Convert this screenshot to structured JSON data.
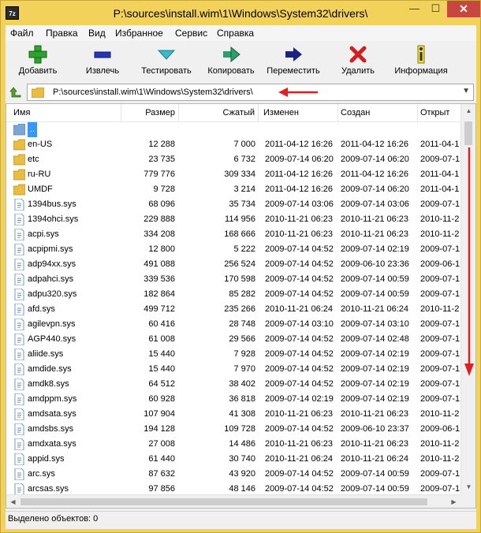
{
  "window": {
    "title": "P:\\sources\\install.wim\\1\\Windows\\System32\\drivers\\",
    "app_icon_text": "7z",
    "min_glyph": "—",
    "max_glyph": "☐",
    "close_glyph": "✕"
  },
  "menu": [
    "Файл",
    "Правка",
    "Вид",
    "Избранное",
    "Сервис",
    "Справка"
  ],
  "toolbar": [
    {
      "label": "Добавить",
      "icon": "plus-icon",
      "color": "#2ea12e"
    },
    {
      "label": "Извлечь",
      "icon": "minus-icon",
      "color": "#2436b8"
    },
    {
      "label": "Тестировать",
      "icon": "check-arrow-icon",
      "color": "#3bb8c9"
    },
    {
      "label": "Копировать",
      "icon": "copy-arrow-icon",
      "color": "#2e9d6f"
    },
    {
      "label": "Переместить",
      "icon": "move-arrow-icon",
      "color": "#1a237e"
    },
    {
      "label": "Удалить",
      "icon": "delete-x-icon",
      "color": "#d11f1f"
    },
    {
      "label": "Информация",
      "icon": "info-icon",
      "color": "#e3c61c"
    }
  ],
  "address": {
    "path": "P:\\sources\\install.wim\\1\\Windows\\System32\\drivers\\",
    "annotation_color": "#e02020"
  },
  "columns": [
    "Имя",
    "Размер",
    "Сжатый",
    "Изменен",
    "Создан",
    "Открыт"
  ],
  "rows": [
    {
      "name": "..",
      "type": "up",
      "size": "",
      "packed": "",
      "modified": "",
      "created": "",
      "accessed": ""
    },
    {
      "name": "en-US",
      "type": "folder",
      "size": "12 288",
      "packed": "7 000",
      "modified": "2011-04-12 16:26",
      "created": "2011-04-12 16:26",
      "accessed": "2011-04-1"
    },
    {
      "name": "etc",
      "type": "folder",
      "size": "23 735",
      "packed": "6 732",
      "modified": "2009-07-14 06:20",
      "created": "2009-07-14 06:20",
      "accessed": "2009-07-1"
    },
    {
      "name": "ru-RU",
      "type": "folder",
      "size": "779 776",
      "packed": "309 334",
      "modified": "2011-04-12 16:26",
      "created": "2011-04-12 16:26",
      "accessed": "2011-04-1"
    },
    {
      "name": "UMDF",
      "type": "folder",
      "size": "9 728",
      "packed": "3 214",
      "modified": "2011-04-12 16:26",
      "created": "2009-07-14 06:20",
      "accessed": "2011-04-1"
    },
    {
      "name": "1394bus.sys",
      "type": "file",
      "size": "68 096",
      "packed": "35 734",
      "modified": "2009-07-14 03:06",
      "created": "2009-07-14 03:06",
      "accessed": "2009-07-1"
    },
    {
      "name": "1394ohci.sys",
      "type": "file",
      "size": "229 888",
      "packed": "114 956",
      "modified": "2010-11-21 06:23",
      "created": "2010-11-21 06:23",
      "accessed": "2010-11-2"
    },
    {
      "name": "acpi.sys",
      "type": "file",
      "size": "334 208",
      "packed": "168 666",
      "modified": "2010-11-21 06:23",
      "created": "2010-11-21 06:23",
      "accessed": "2010-11-2"
    },
    {
      "name": "acpipmi.sys",
      "type": "file",
      "size": "12 800",
      "packed": "5 222",
      "modified": "2009-07-14 04:52",
      "created": "2009-07-14 02:19",
      "accessed": "2009-07-1"
    },
    {
      "name": "adp94xx.sys",
      "type": "file",
      "size": "491 088",
      "packed": "256 524",
      "modified": "2009-07-14 04:52",
      "created": "2009-06-10 23:36",
      "accessed": "2009-06-1"
    },
    {
      "name": "adpahci.sys",
      "type": "file",
      "size": "339 536",
      "packed": "170 598",
      "modified": "2009-07-14 04:52",
      "created": "2009-07-14 00:59",
      "accessed": "2009-07-1"
    },
    {
      "name": "adpu320.sys",
      "type": "file",
      "size": "182 864",
      "packed": "85 282",
      "modified": "2009-07-14 04:52",
      "created": "2009-07-14 00:59",
      "accessed": "2009-07-1"
    },
    {
      "name": "afd.sys",
      "type": "file",
      "size": "499 712",
      "packed": "235 266",
      "modified": "2010-11-21 06:24",
      "created": "2010-11-21 06:24",
      "accessed": "2010-11-2"
    },
    {
      "name": "agilevpn.sys",
      "type": "file",
      "size": "60 416",
      "packed": "28 748",
      "modified": "2009-07-14 03:10",
      "created": "2009-07-14 03:10",
      "accessed": "2009-07-1"
    },
    {
      "name": "AGP440.sys",
      "type": "file",
      "size": "61 008",
      "packed": "29 566",
      "modified": "2009-07-14 04:52",
      "created": "2009-07-14 02:48",
      "accessed": "2009-07-1"
    },
    {
      "name": "aliide.sys",
      "type": "file",
      "size": "15 440",
      "packed": "7 928",
      "modified": "2009-07-14 04:52",
      "created": "2009-07-14 02:19",
      "accessed": "2009-07-1"
    },
    {
      "name": "amdide.sys",
      "type": "file",
      "size": "15 440",
      "packed": "7 970",
      "modified": "2009-07-14 04:52",
      "created": "2009-07-14 02:19",
      "accessed": "2009-07-1"
    },
    {
      "name": "amdk8.sys",
      "type": "file",
      "size": "64 512",
      "packed": "38 402",
      "modified": "2009-07-14 04:52",
      "created": "2009-07-14 02:19",
      "accessed": "2009-07-1"
    },
    {
      "name": "amdppm.sys",
      "type": "file",
      "size": "60 928",
      "packed": "36 818",
      "modified": "2009-07-14 02:19",
      "created": "2009-07-14 02:19",
      "accessed": "2009-07-1"
    },
    {
      "name": "amdsata.sys",
      "type": "file",
      "size": "107 904",
      "packed": "41 308",
      "modified": "2010-11-21 06:23",
      "created": "2010-11-21 06:23",
      "accessed": "2010-11-2"
    },
    {
      "name": "amdsbs.sys",
      "type": "file",
      "size": "194 128",
      "packed": "109 728",
      "modified": "2009-07-14 04:52",
      "created": "2009-06-10 23:37",
      "accessed": "2009-06-1"
    },
    {
      "name": "amdxata.sys",
      "type": "file",
      "size": "27 008",
      "packed": "14 486",
      "modified": "2010-11-21 06:23",
      "created": "2010-11-21 06:23",
      "accessed": "2010-11-2"
    },
    {
      "name": "appid.sys",
      "type": "file",
      "size": "61 440",
      "packed": "30 740",
      "modified": "2010-11-21 06:24",
      "created": "2010-11-21 06:24",
      "accessed": "2010-11-2"
    },
    {
      "name": "arc.sys",
      "type": "file",
      "size": "87 632",
      "packed": "43 920",
      "modified": "2009-07-14 04:52",
      "created": "2009-07-14 00:59",
      "accessed": "2009-07-1"
    },
    {
      "name": "arcsas.sys",
      "type": "file",
      "size": "97 856",
      "packed": "48 146",
      "modified": "2009-07-14 04:52",
      "created": "2009-07-14 00:59",
      "accessed": "2009-07-1"
    }
  ],
  "status": {
    "selected_text": "Выделено объектов: 0"
  },
  "colors": {
    "title_bar": "#f3d25c",
    "selection": "#3399ff",
    "annotation_arrow": "#e02020"
  }
}
